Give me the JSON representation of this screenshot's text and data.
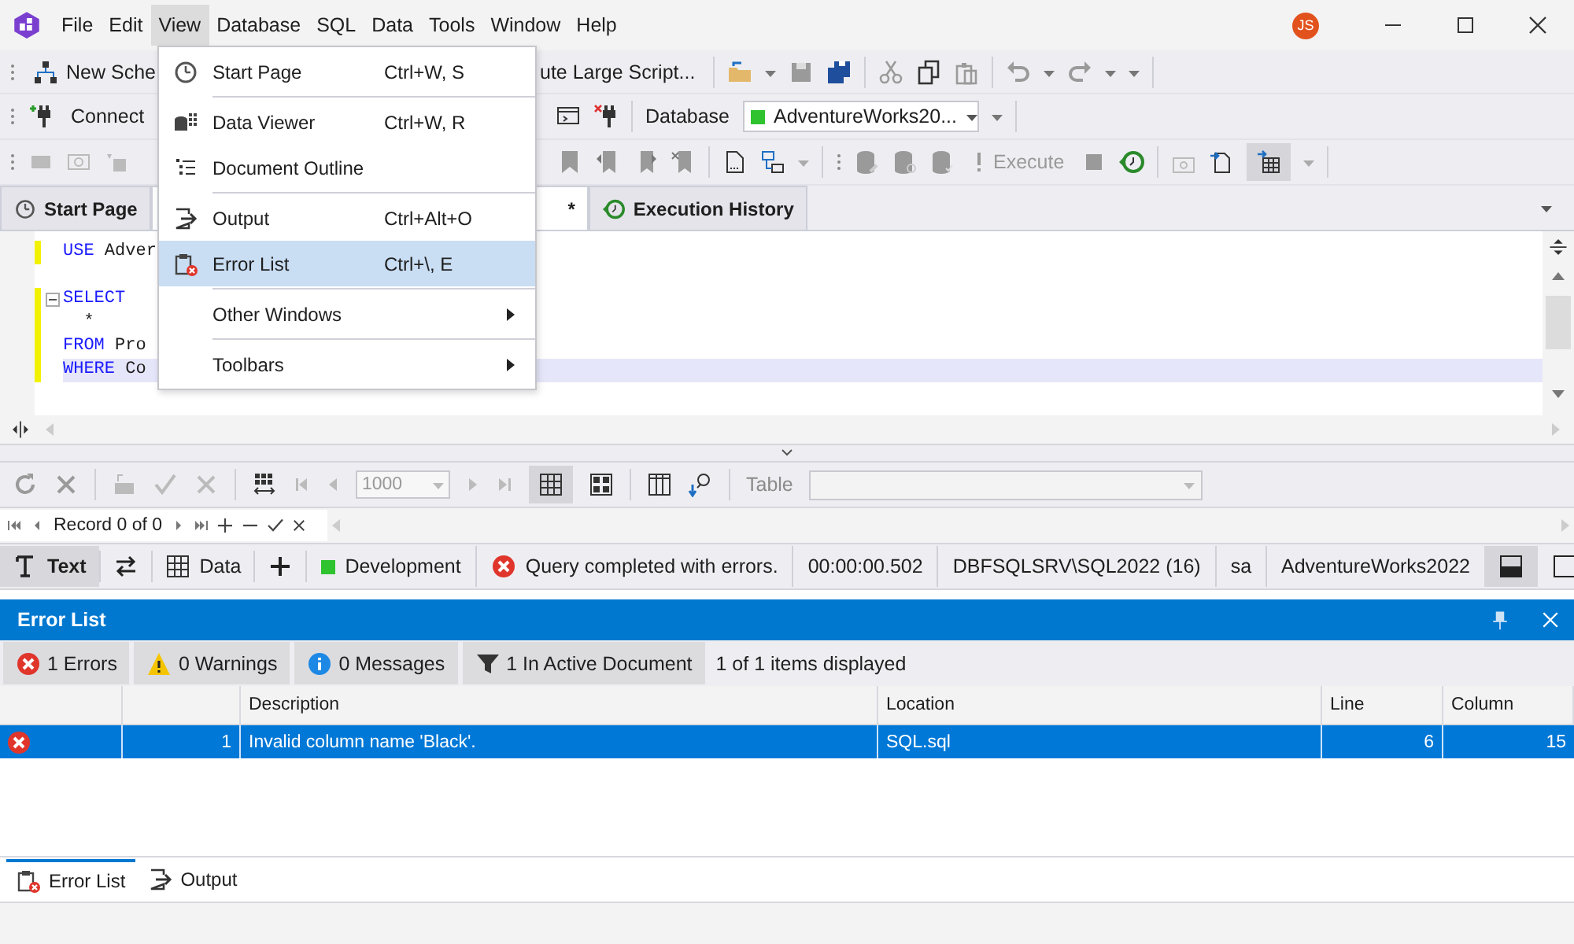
{
  "title_bar": {
    "menu": [
      {
        "label": "File",
        "selected": false
      },
      {
        "label": "Edit",
        "selected": false
      },
      {
        "label": "View",
        "selected": true
      },
      {
        "label": "Database",
        "selected": false
      },
      {
        "label": "SQL",
        "selected": false
      },
      {
        "label": "Data",
        "selected": false
      },
      {
        "label": "Tools",
        "selected": false
      },
      {
        "label": "Window",
        "selected": false
      },
      {
        "label": "Help",
        "selected": false
      }
    ],
    "user_initials": "JS"
  },
  "toolbar_1": {
    "new_schema": "New Sche",
    "execute_large_script": "ute Large Script..."
  },
  "toolbar_2": {
    "connect": "Connect",
    "database_label": "Database",
    "database_value": "AdventureWorks20..."
  },
  "toolbar_3": {
    "execute": "Execute",
    "execute_disabled": true
  },
  "doc_tabs": [
    {
      "label": "Start Page",
      "selected": false
    },
    {
      "label": "*",
      "selected": true
    },
    {
      "label": "Execution History",
      "selected": false
    }
  ],
  "editor": {
    "lines": [
      {
        "kind": "code",
        "keyword": "USE",
        "text": "Adver",
        "current": false,
        "fold_start": false
      },
      {
        "kind": "blank"
      },
      {
        "kind": "code",
        "keyword": "SELECT",
        "current": false,
        "fold_start": true
      },
      {
        "kind": "code",
        "text": "  *",
        "current": false,
        "fold_start": false
      },
      {
        "kind": "code",
        "keyword": "FROM",
        "text": "Pro",
        "current": false,
        "fold_start": false
      },
      {
        "kind": "code",
        "keyword": "WHERE",
        "text": "Co",
        "current": true,
        "fold_start": false
      }
    ]
  },
  "grid_toolbar": {
    "page_size": "1000",
    "table_label": "Table"
  },
  "record_nav": {
    "text": "Record 0 of 0"
  },
  "status_bar": {
    "view_tabs": [
      {
        "label": "Text",
        "selected": true
      },
      {
        "label": "Data",
        "selected": false
      }
    ],
    "environment": "Development",
    "message": "Query completed with errors.",
    "elapsed": "00:00:00.502",
    "server": "DBFSQLSRV\\SQL2022 (16)",
    "user": "sa",
    "database": "AdventureWorks2022"
  },
  "error_list": {
    "title": "Error List",
    "filters": [
      {
        "kind": "errors",
        "label": "1 Errors",
        "selected": true
      },
      {
        "kind": "warnings",
        "label": "0 Warnings",
        "selected": true
      },
      {
        "kind": "messages",
        "label": "0 Messages",
        "selected": true
      },
      {
        "kind": "active_document",
        "label": "1 In Active Document",
        "selected": true
      }
    ],
    "summary": "1 of 1 items displayed",
    "columns": [
      "Description",
      "Location",
      "Line",
      "Column"
    ],
    "rows": [
      {
        "number": "1",
        "description": "Invalid column name 'Black'.",
        "location": "SQL.sql",
        "line": "6",
        "column": "15",
        "selected": true
      }
    ]
  },
  "bottom_tabs": [
    {
      "label": "Error List",
      "selected": true
    },
    {
      "label": "Output",
      "selected": false
    }
  ],
  "view_menu": {
    "items": [
      {
        "kind": "item",
        "label": "Start Page",
        "shortcut": "Ctrl+W, S",
        "highlighted": false
      },
      {
        "kind": "separator"
      },
      {
        "kind": "item",
        "label": "Data Viewer",
        "shortcut": "Ctrl+W, R",
        "highlighted": false
      },
      {
        "kind": "item",
        "label": "Document Outline",
        "highlighted": false
      },
      {
        "kind": "separator"
      },
      {
        "kind": "item",
        "label": "Output",
        "shortcut": "Ctrl+Alt+O",
        "highlighted": false
      },
      {
        "kind": "item",
        "label": "Error List",
        "shortcut": "Ctrl+\\, E",
        "highlighted": true
      },
      {
        "kind": "separator"
      },
      {
        "kind": "submenu",
        "label": "Other Windows",
        "highlighted": false
      },
      {
        "kind": "separator"
      },
      {
        "kind": "submenu",
        "label": "Toolbars",
        "highlighted": false
      }
    ]
  }
}
